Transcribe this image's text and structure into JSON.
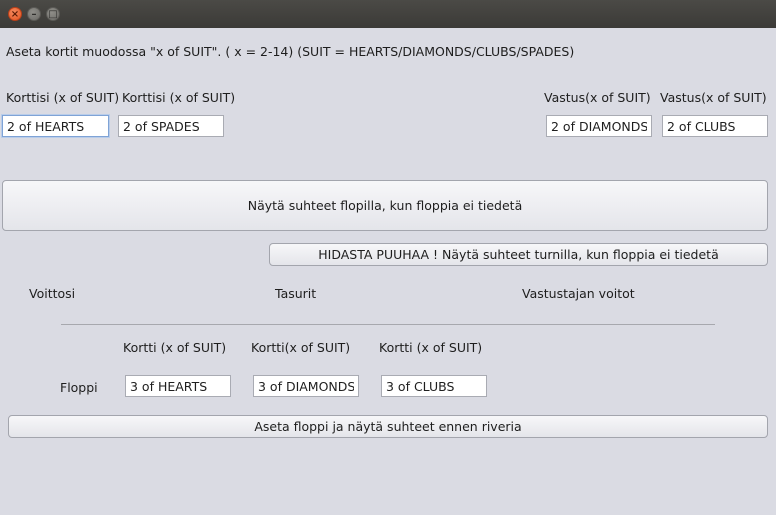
{
  "window": {
    "close_glyph": "×",
    "minimize_glyph": "–",
    "maximize_glyph": "□"
  },
  "instructions": "Aseta kortit muodossa \"x of SUIT\". ( x = 2-14) (SUIT  = HEARTS/DIAMONDS/CLUBS/SPADES)",
  "your_cards": {
    "label1": "Korttisi (x of SUIT)",
    "label2": "Korttisi (x of SUIT)",
    "value1": "2 of HEARTS",
    "value2": "2 of SPADES"
  },
  "opponent_cards": {
    "label1": "Vastus(x of SUIT)",
    "label2": "Vastus(x of SUIT)",
    "value1": "2 of DIAMONDS",
    "value2": "2 of CLUBS"
  },
  "buttons": {
    "flop_odds": "Näytä suhteet flopilla, kun floppia ei tiedetä",
    "turn_odds": "HIDASTA PUUHAA ! Näytä suhteet turnilla, kun floppia ei tiedetä",
    "set_flop": "Aseta floppi ja näytä suhteet ennen riveria"
  },
  "results": {
    "wins": "Voittosi",
    "ties": "Tasurit",
    "opponent_wins": "Vastustajan voitot"
  },
  "flop": {
    "label": "Floppi",
    "card_label1": "Kortti (x of SUIT)",
    "card_label2": "Kortti(x of SUIT)",
    "card_label3": "Kortti (x of SUIT)",
    "value1": "3 of HEARTS",
    "value2": "3 of DIAMONDS",
    "value3": "3 of CLUBS"
  }
}
